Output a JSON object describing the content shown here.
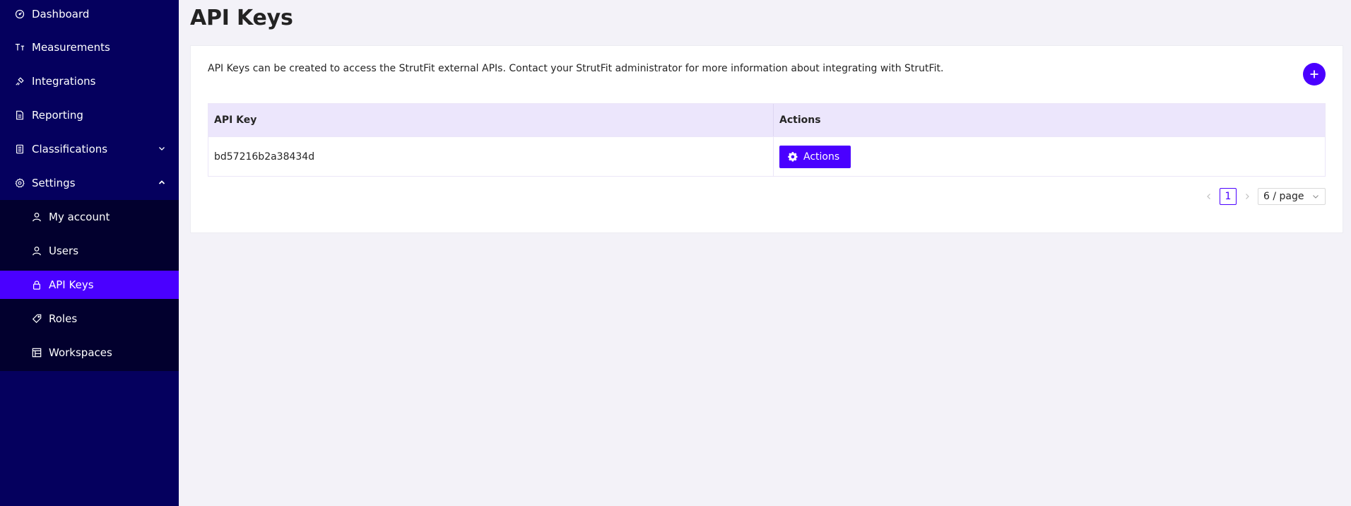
{
  "sidebar": {
    "items": [
      {
        "label": "Dashboard",
        "icon": "dashboard-icon"
      },
      {
        "label": "Measurements",
        "icon": "measurements-icon"
      },
      {
        "label": "Integrations",
        "icon": "integrations-icon"
      },
      {
        "label": "Reporting",
        "icon": "reporting-icon"
      },
      {
        "label": "Classifications",
        "icon": "classifications-icon",
        "expanded": false
      },
      {
        "label": "Settings",
        "icon": "settings-icon",
        "expanded": true
      }
    ],
    "settings_children": [
      {
        "label": "My account",
        "icon": "user-icon"
      },
      {
        "label": "Users",
        "icon": "user-icon"
      },
      {
        "label": "API Keys",
        "icon": "lock-icon",
        "active": true
      },
      {
        "label": "Roles",
        "icon": "tag-icon"
      },
      {
        "label": "Workspaces",
        "icon": "workspaces-icon"
      }
    ]
  },
  "page": {
    "title": "API Keys",
    "intro": "API Keys can be created to access the StrutFit external APIs. Contact your StrutFit administrator for more information about integrating with StrutFit."
  },
  "table": {
    "columns": [
      "API Key",
      "Actions"
    ],
    "rows": [
      {
        "api_key": "bd57216b2a38434d",
        "action_label": "Actions"
      }
    ]
  },
  "pagination": {
    "current_page": "1",
    "page_size": "6 / page"
  },
  "colors": {
    "sidebar_bg": "#05005e",
    "submenu_bg": "#02002e",
    "accent": "#4a00ff",
    "table_header_bg": "#ece6fc",
    "page_bg": "#f3f2f8"
  }
}
